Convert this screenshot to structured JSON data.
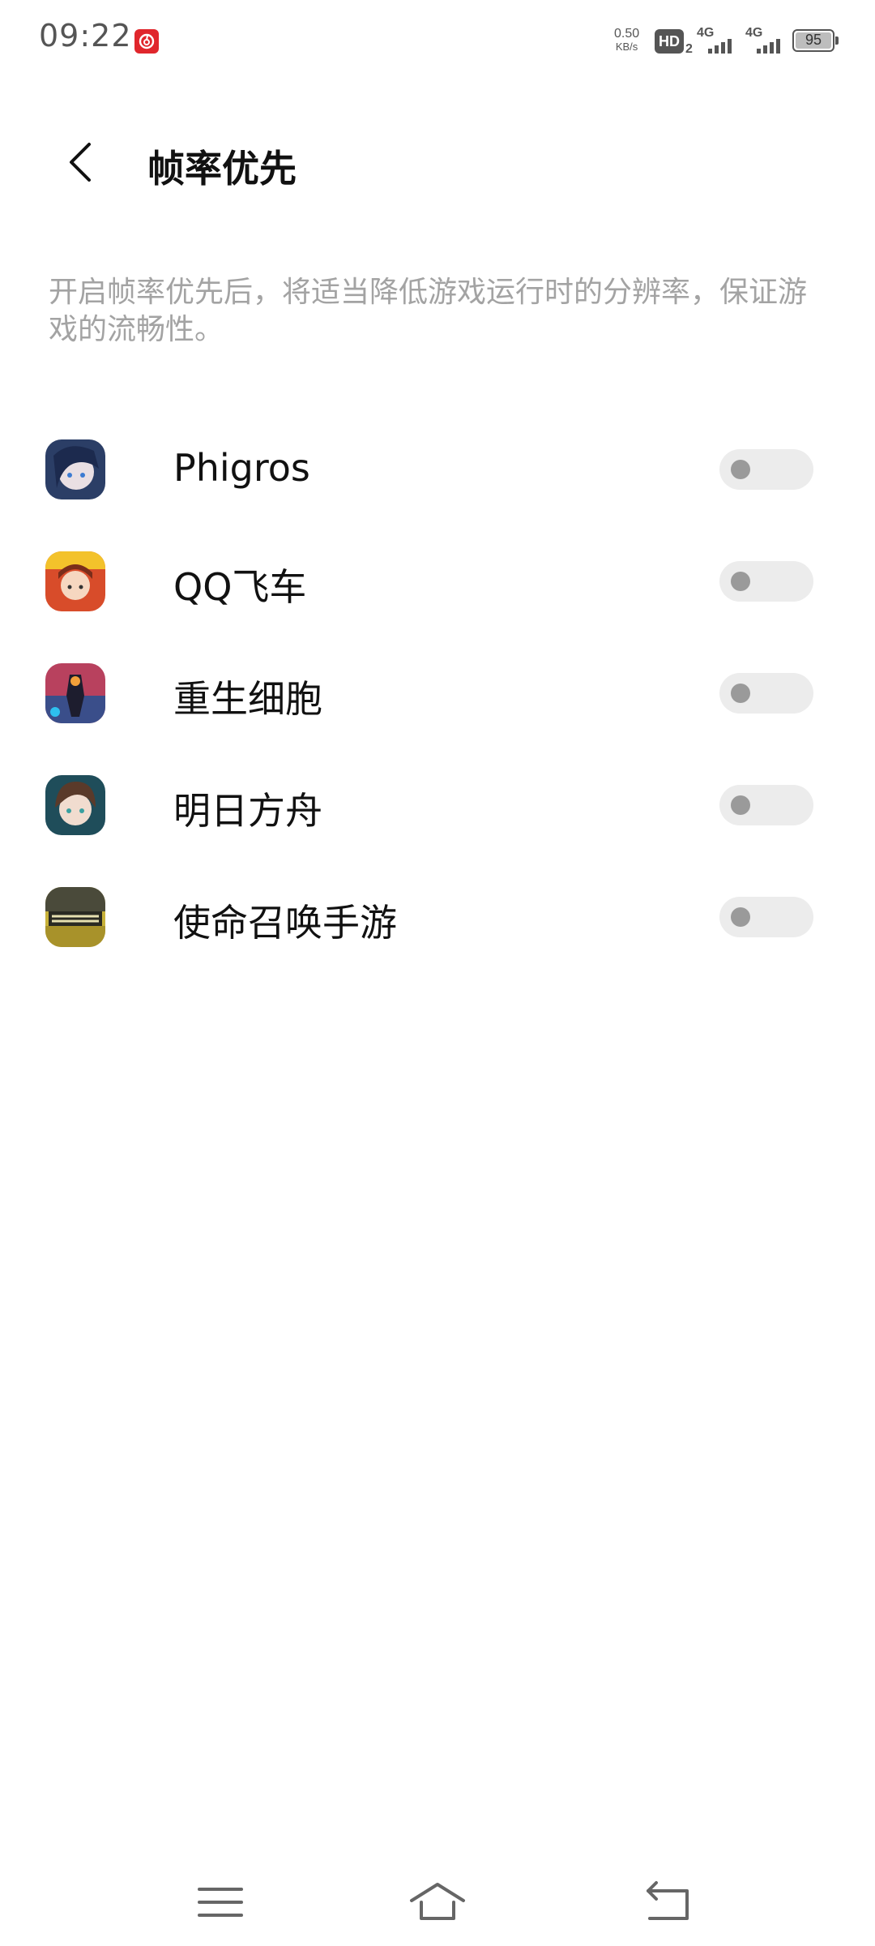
{
  "status_bar": {
    "time": "09:22",
    "net_speed_value": "0.50",
    "net_speed_unit": "KB/s",
    "hd_label": "HD",
    "hd_sub": "2",
    "signal_1_label": "4G",
    "signal_2_label": "4G",
    "battery_level": "95"
  },
  "header": {
    "title": "帧率优先"
  },
  "description": "开启帧率优先后，将适当降低游戏运行时的分辨率，保证游戏的流畅性。",
  "apps": [
    {
      "name": "Phigros",
      "enabled": false,
      "icon": "phigros-icon"
    },
    {
      "name": "QQ飞车",
      "enabled": false,
      "icon": "qq-speed-icon"
    },
    {
      "name": "重生细胞",
      "enabled": false,
      "icon": "dead-cells-icon"
    },
    {
      "name": "明日方舟",
      "enabled": false,
      "icon": "arknights-icon"
    },
    {
      "name": "使命召唤手游",
      "enabled": false,
      "icon": "call-of-duty-icon"
    }
  ],
  "colors": {
    "toggle_off_track": "#ececec",
    "toggle_off_knob": "#9a9a9a",
    "description_text": "#a3a3a3"
  }
}
